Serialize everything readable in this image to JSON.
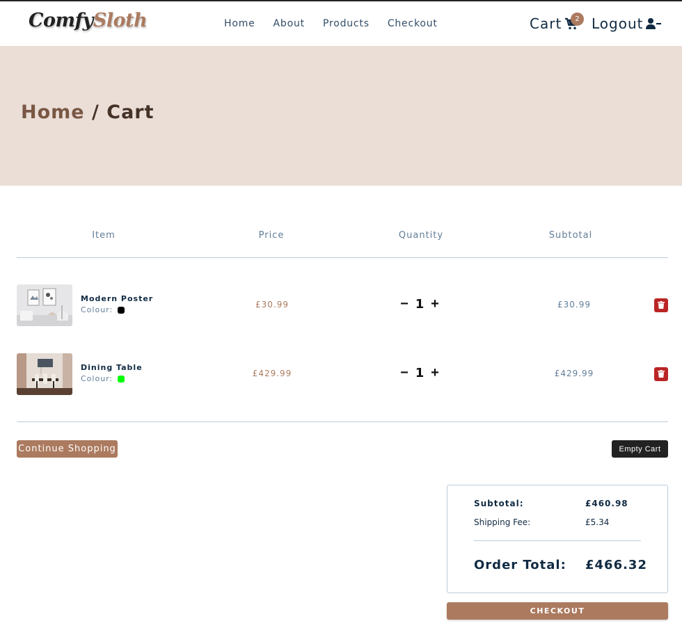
{
  "brand": {
    "part1": "Comfy",
    "part2": "Sloth"
  },
  "nav": {
    "links": [
      {
        "label": "Home"
      },
      {
        "label": "About"
      },
      {
        "label": "Products"
      },
      {
        "label": "Checkout"
      }
    ],
    "cart_label": "Cart",
    "cart_count": "2",
    "logout_label": "Logout"
  },
  "hero": {
    "crumb_home": "Home",
    "separator": " / ",
    "current": "Cart"
  },
  "table": {
    "headers": {
      "item": "Item",
      "price": "Price",
      "quantity": "Quantity",
      "subtotal": "Subtotal"
    },
    "colour_label": "Colour:",
    "items": [
      {
        "name": "Modern Poster",
        "colour": "#000000",
        "price": "£30.99",
        "quantity": "1",
        "subtotal": "£30.99"
      },
      {
        "name": "Dining Table",
        "colour": "#00ff00",
        "price": "£429.99",
        "quantity": "1",
        "subtotal": "£429.99"
      }
    ],
    "minus": "−",
    "plus": "+"
  },
  "actions": {
    "continue": "Continue Shopping",
    "empty": "Empty Cart"
  },
  "totals": {
    "subtotal_label": "Subtotal:",
    "subtotal_value": "£460.98",
    "shipping_label": "Shipping Fee:",
    "shipping_value": "£5.34",
    "order_label": "Order Total:",
    "order_value": "£466.32"
  },
  "checkout_button": "CHECKOUT",
  "colors": {
    "accent": "#ab7a5f",
    "hero_bg": "#eaded7",
    "danger": "#bb2525",
    "dark": "#222222"
  },
  "icons": {
    "cart": "shopping-cart-icon",
    "logout": "user-minus-icon",
    "delete": "trash-icon"
  }
}
